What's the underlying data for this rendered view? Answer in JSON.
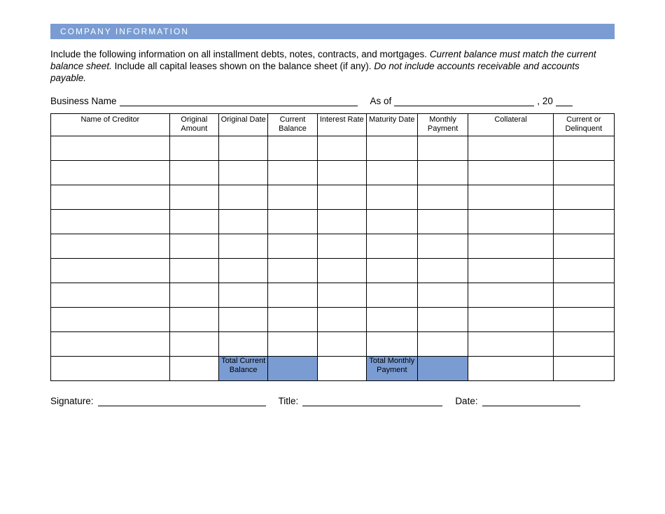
{
  "header": {
    "title": "COMPANY INFORMATION"
  },
  "instructions": {
    "p1a": "Include the following information on all installment debts, notes, contracts, and mortgages.  ",
    "p1b": "Current balance must match the current balance sheet.",
    "p2a": "  Include all capital leases shown on the balance sheet (if any).  ",
    "p2b": "Do not include accounts receivable and accounts payable."
  },
  "business": {
    "label": "Business Name",
    "asof_label": "As of",
    "comma_year": ", 20"
  },
  "columns": {
    "c0": "Name of Creditor",
    "c1": "Original Amount",
    "c2": "Original Date",
    "c3": "Current Balance",
    "c4": "Interest Rate",
    "c5": "Maturity Date",
    "c6": "Monthly Payment",
    "c7": "Collateral",
    "c8": "Current or Delinquent"
  },
  "totals": {
    "cur_balance": "Total Current Balance",
    "monthly": "Total Monthly Payment"
  },
  "signature": {
    "sig": "Signature:",
    "title": "Title:",
    "date": "Date:"
  }
}
